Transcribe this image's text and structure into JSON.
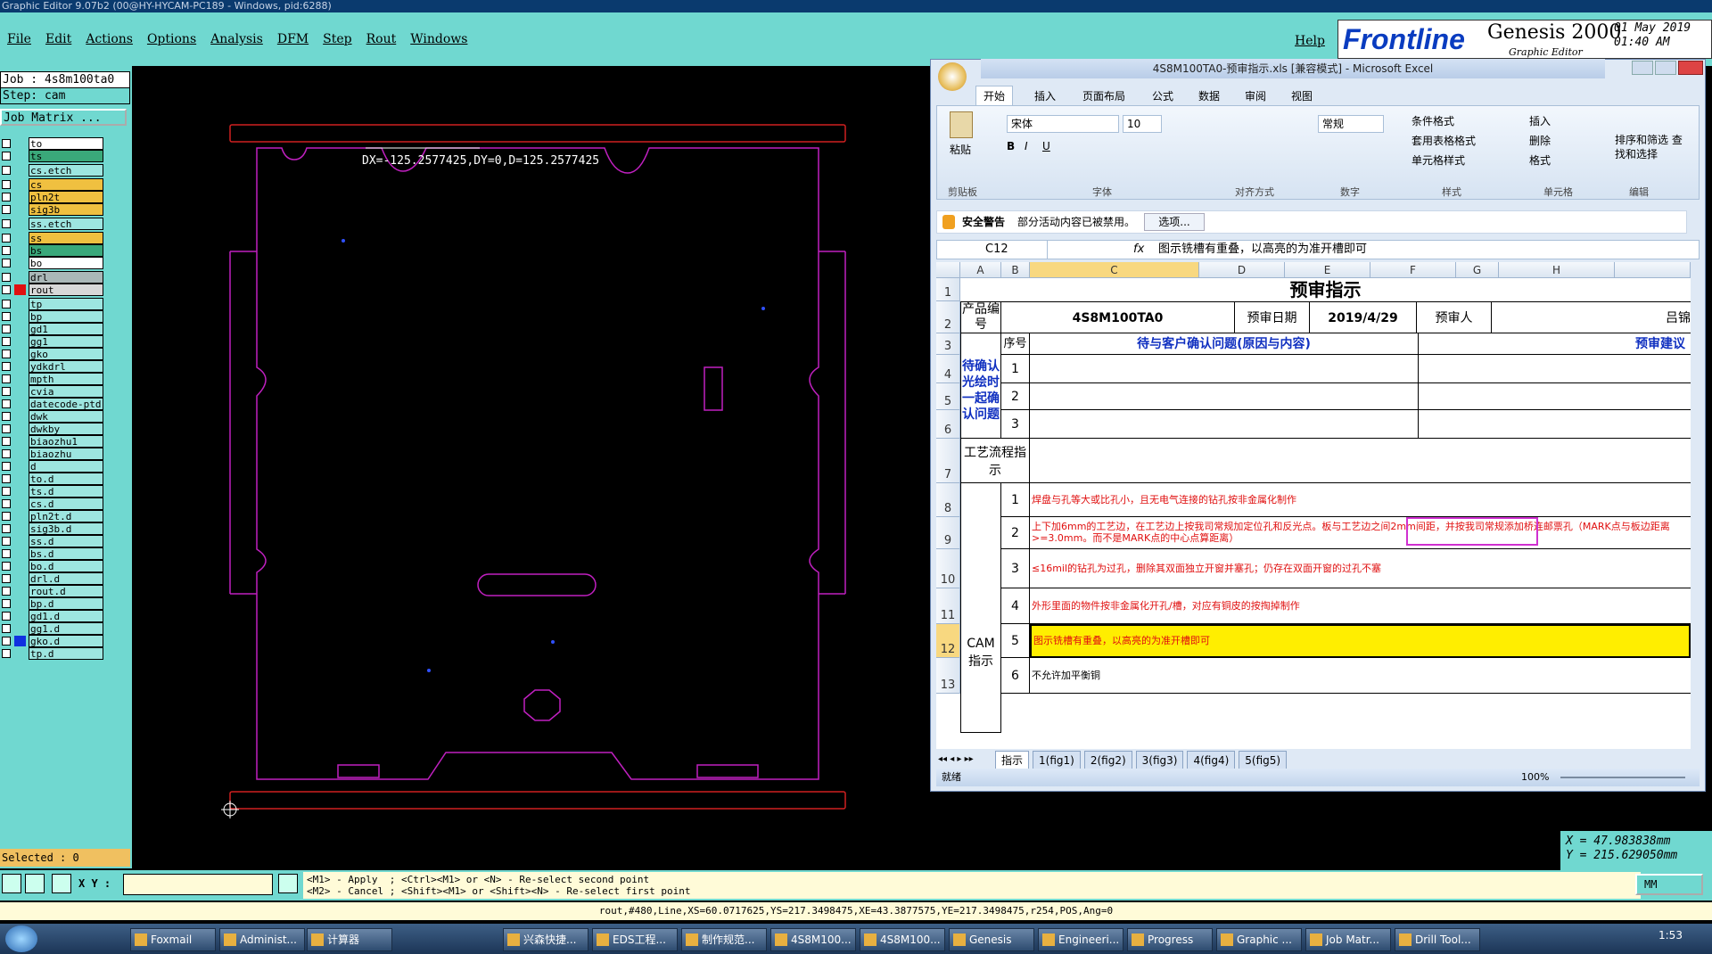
{
  "genesis": {
    "title": "Graphic Editor 9.07b2 (00@HY-HYCAM-PC189 - Windows, pid:6288)",
    "menus": [
      "File",
      "Edit",
      "Actions",
      "Options",
      "Analysis",
      "DFM",
      "Step",
      "Rout",
      "Windows"
    ],
    "help": "Help",
    "logo_brand": "Frontline",
    "logo_product": "Genesis 2000",
    "logo_sub": "Graphic Editor",
    "date": "01 May 2019",
    "time": "01:40 AM",
    "job": "Job : 4s8m100ta0",
    "step": "Step: cam",
    "job_matrix": "Job Matrix ...",
    "layers": [
      {
        "name": "to",
        "bg": "#ffffff",
        "mark": true
      },
      {
        "name": "ts",
        "bg": "#3aa87a",
        "mark": false
      },
      {
        "name": "cs.etch",
        "bg": "#9de6e0",
        "mark": false
      },
      {
        "name": "cs",
        "bg": "#f0c040",
        "mark": false
      },
      {
        "name": "pln2t",
        "bg": "#f0c040",
        "mark": false
      },
      {
        "name": "sig3b",
        "bg": "#f0c040",
        "mark": true
      },
      {
        "name": "ss.etch",
        "bg": "#9de6e0",
        "mark": false
      },
      {
        "name": "ss",
        "bg": "#f0c040",
        "mark": false
      },
      {
        "name": "bs",
        "bg": "#3aa87a",
        "mark": false
      },
      {
        "name": "bo",
        "bg": "#ffffff",
        "mark": true
      },
      {
        "name": "drl",
        "bg": "#aab8b8",
        "mark": false
      },
      {
        "name": "rout",
        "bg": "#d8d8d8",
        "mark": true
      },
      {
        "name": "tp",
        "bg": "#9de6e0",
        "mark": false
      },
      {
        "name": "bp",
        "bg": "#9de6e0",
        "mark": false
      },
      {
        "name": "gd1",
        "bg": "#9de6e0",
        "mark": true
      },
      {
        "name": "gg1",
        "bg": "#9de6e0",
        "mark": false
      },
      {
        "name": "gko",
        "bg": "#9de6e0",
        "mark": true
      },
      {
        "name": "ydkdrl",
        "bg": "#9de6e0",
        "mark": false
      },
      {
        "name": "mpth",
        "bg": "#9de6e0",
        "mark": false
      },
      {
        "name": "cvia",
        "bg": "#9de6e0",
        "mark": false
      },
      {
        "name": "datecode-ptd",
        "bg": "#9de6e0",
        "mark": false
      },
      {
        "name": "dwk",
        "bg": "#9de6e0",
        "mark": false
      },
      {
        "name": "dwkby",
        "bg": "#9de6e0",
        "mark": false
      },
      {
        "name": "biaozhu1",
        "bg": "#9de6e0",
        "mark": false
      },
      {
        "name": "biaozhu",
        "bg": "#9de6e0",
        "mark": false
      },
      {
        "name": "d",
        "bg": "#9de6e0",
        "mark": false
      },
      {
        "name": "to.d",
        "bg": "#9de6e0",
        "mark": true
      },
      {
        "name": "ts.d",
        "bg": "#9de6e0",
        "mark": false
      },
      {
        "name": "cs.d",
        "bg": "#9de6e0",
        "mark": false
      },
      {
        "name": "pln2t.d",
        "bg": "#9de6e0",
        "mark": false
      },
      {
        "name": "sig3b.d",
        "bg": "#9de6e0",
        "mark": true
      },
      {
        "name": "ss.d",
        "bg": "#9de6e0",
        "mark": false
      },
      {
        "name": "bs.d",
        "bg": "#9de6e0",
        "mark": false
      },
      {
        "name": "bo.d",
        "bg": "#9de6e0",
        "mark": true
      },
      {
        "name": "drl.d",
        "bg": "#9de6e0",
        "mark": false
      },
      {
        "name": "rout.d",
        "bg": "#9de6e0",
        "mark": false
      },
      {
        "name": "bp.d",
        "bg": "#9de6e0",
        "mark": false
      },
      {
        "name": "gd1.d",
        "bg": "#9de6e0",
        "mark": true
      },
      {
        "name": "gg1.d",
        "bg": "#9de6e0",
        "mark": false
      },
      {
        "name": "gko.d",
        "bg": "#9de6e0",
        "mark": true
      },
      {
        "name": "tp.d",
        "bg": "#9de6e0",
        "mark": false
      }
    ],
    "selected": "Selected : 0",
    "measure": "DX=-125.2577425,DY=0,D=125.2577425",
    "xy_label": "X Y :",
    "hint1": "<M1> - Apply  ; <Ctrl><M1> or <N> - Re-select second point",
    "hint2": "<M2> - Cancel ; <Shift><M1> or <Shift><N> - Re-select first point",
    "cmdline": "rout,#480,Line,XS=60.0717625,YS=217.3498475,XE=43.3877575,YE=217.3498475,r254,POS,Ang=0",
    "coord_x": "X = 47.983838mm",
    "coord_y": "Y = 215.629050mm",
    "units": "MM"
  },
  "excel": {
    "title": "4S8M100TA0-预审指示.xls  [兼容模式] - Microsoft Excel",
    "tabs": [
      "开始",
      "插入",
      "页面布局",
      "公式",
      "数据",
      "审阅",
      "视图"
    ],
    "groups": [
      "剪贴板",
      "字体",
      "对齐方式",
      "数字",
      "样式",
      "单元格",
      "编辑"
    ],
    "paste": "粘贴",
    "font_name": "宋体",
    "font_size": "10",
    "number_format": "常规",
    "style_items": [
      "条件格式",
      "套用表格格式",
      "单元格样式"
    ],
    "cell_items": [
      "插入",
      "删除",
      "格式"
    ],
    "edit_items": [
      "排序和筛选",
      "查找和选择"
    ],
    "security_label": "安全警告",
    "security_msg": "部分活动内容已被禁用。",
    "options_btn": "选项...",
    "namebox": "C12",
    "fx": "fx",
    "formula": "图示铣槽有重叠，以高亮的为准开槽即可",
    "cols": [
      "A",
      "B",
      "C",
      "D",
      "E",
      "F",
      "G",
      "H"
    ],
    "rows": [
      "1",
      "2",
      "3",
      "4",
      "5",
      "6",
      "7",
      "8",
      "9",
      "10",
      "11",
      "12",
      "13"
    ],
    "sheet_title": "预审指示",
    "product_label": "产品编号",
    "product_value": "4S8M100TA0",
    "date_label": "预审日期",
    "date_value": "2019/4/29",
    "reviewer_label": "预审人",
    "reviewer_value": "吕锦",
    "seq_label": "序号",
    "confirm_header": "待与客户确认问题(原因与内容)",
    "suggest_header": "预审建议",
    "pending_label": "待确认光绘时一起确认问题",
    "pending_seq": [
      "1",
      "2",
      "3"
    ],
    "process_label": "工艺流程指示",
    "cam_label": "CAM指示",
    "cam_items": [
      {
        "seq": "1",
        "text": "焊盘与孔等大或比孔小，且无电气连接的钻孔按非金属化制作"
      },
      {
        "seq": "2",
        "text": "上下加6mm的工艺边，在工艺边上按我司常规加定位孔和反光点。板与工艺边之间2mm间距，并按我司常规添加桥连邮票孔（MARK点与板边距离>=3.0mm。而不是MARK点的中心点算距离）",
        "highlight": "并按我司常规添加桥连邮票孔"
      },
      {
        "seq": "3",
        "text": "≤16mil的钻孔为过孔，删除其双面独立开窗并塞孔；仍存在双面开窗的过孔不塞"
      },
      {
        "seq": "4",
        "text": "外形里面的物件按非金属化开孔/槽，对应有铜皮的按掏掉制作"
      },
      {
        "seq": "5",
        "text": "图示铣槽有重叠，以高亮的为准开槽即可"
      },
      {
        "seq": "6",
        "text": "不允许加平衡铜"
      }
    ],
    "sheets": [
      "指示",
      "1(fig1)",
      "2(fig2)",
      "3(fig3)",
      "4(fig4)",
      "5(fig5)"
    ],
    "status": "就绪",
    "zoom": "100%"
  },
  "taskbar": {
    "items": [
      "Foxmail",
      "Administ...",
      "计算器",
      "兴森快捷...",
      "EDS工程...",
      "制作规范...",
      "4S8M100...",
      "4S8M100...",
      "Genesis",
      "Engineeri...",
      "Progress",
      "Graphic ...",
      "Job Matr...",
      "Drill Tool..."
    ],
    "clock": "1:53"
  }
}
